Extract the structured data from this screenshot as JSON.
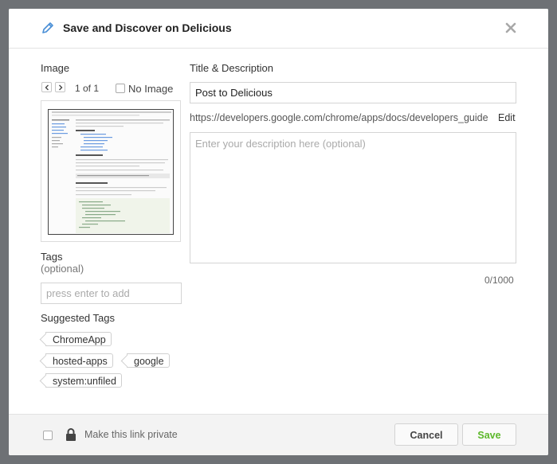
{
  "dialog": {
    "title": "Save and Discover on Delicious"
  },
  "image_section": {
    "label": "Image",
    "counter": "1 of 1",
    "no_image_label": "No Image"
  },
  "tags_section": {
    "label": "Tags",
    "sublabel": "(optional)",
    "input_placeholder": "press enter to add",
    "suggested_label": "Suggested Tags",
    "suggested": [
      "ChromeApp",
      "hosted-apps",
      "google",
      "system:unfiled"
    ]
  },
  "details": {
    "label": "Title & Description",
    "title_value": "Post to Delicious",
    "url": "https://developers.google.com/chrome/apps/docs/developers_guide",
    "edit_label": "Edit",
    "description_placeholder": "Enter your description here (optional)",
    "char_count": "0/1000"
  },
  "footer": {
    "private_label": "Make this link private",
    "cancel_label": "Cancel",
    "save_label": "Save"
  },
  "colors": {
    "backdrop": "#6e7175",
    "save_text": "#5cb82a",
    "icon_blue": "#4a8fd6"
  }
}
